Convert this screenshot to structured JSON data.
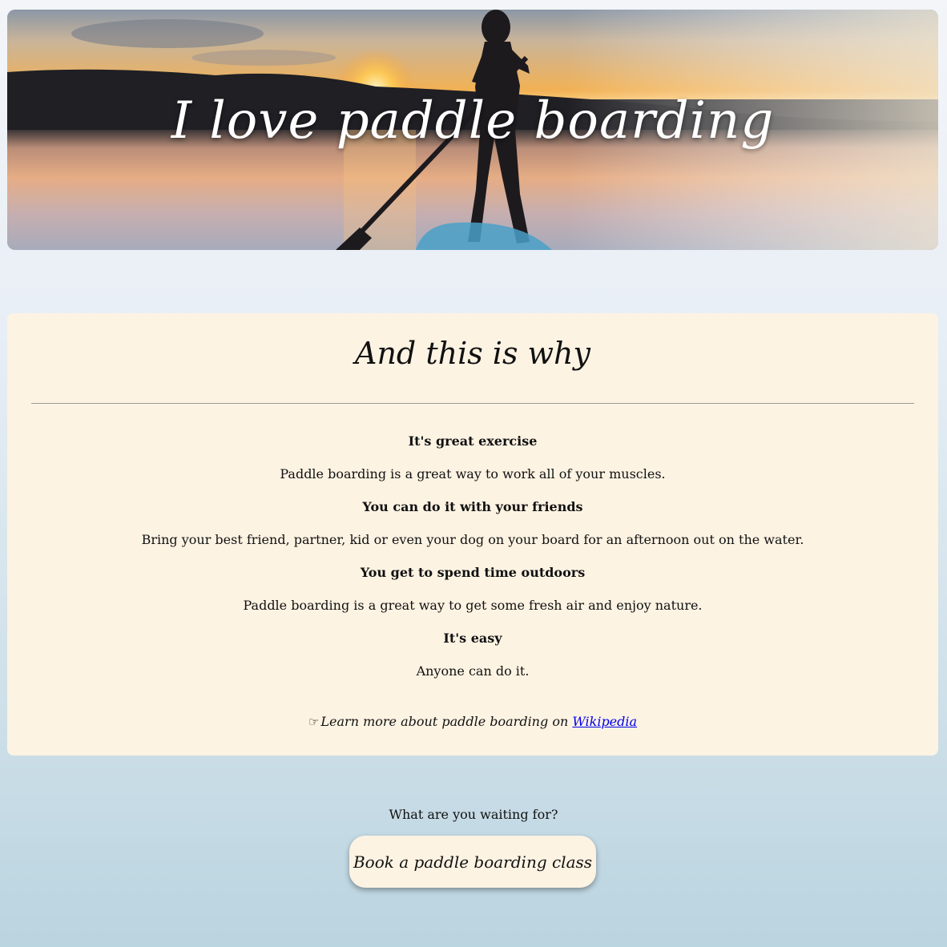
{
  "hero": {
    "title": "I love paddle boarding",
    "image": "sunset-paddle-boarder-photo"
  },
  "reasons_section": {
    "heading": "And this is why",
    "items": [
      {
        "title": "It's great exercise",
        "text": "Paddle boarding is a great way to work all of your muscles."
      },
      {
        "title": "You can do it with your friends",
        "text": "Bring your best friend, partner, kid or even your dog on your board for an afternoon out on the water."
      },
      {
        "title": "You get to spend time outdoors",
        "text": "Paddle boarding is a great way to get some fresh air and enjoy nature."
      },
      {
        "title": "It's easy",
        "text": "Anyone can do it."
      }
    ],
    "learn_more": {
      "icon": "pointing-hand-icon",
      "text": "Learn more about paddle boarding on ",
      "link_label": "Wikipedia"
    }
  },
  "cta": {
    "question": "What are you waiting for?",
    "button_label": "Book a paddle boarding class"
  },
  "colors": {
    "card_background": "#fdf3e3",
    "link": "#0000ee",
    "hero_title": "#ffffff"
  }
}
